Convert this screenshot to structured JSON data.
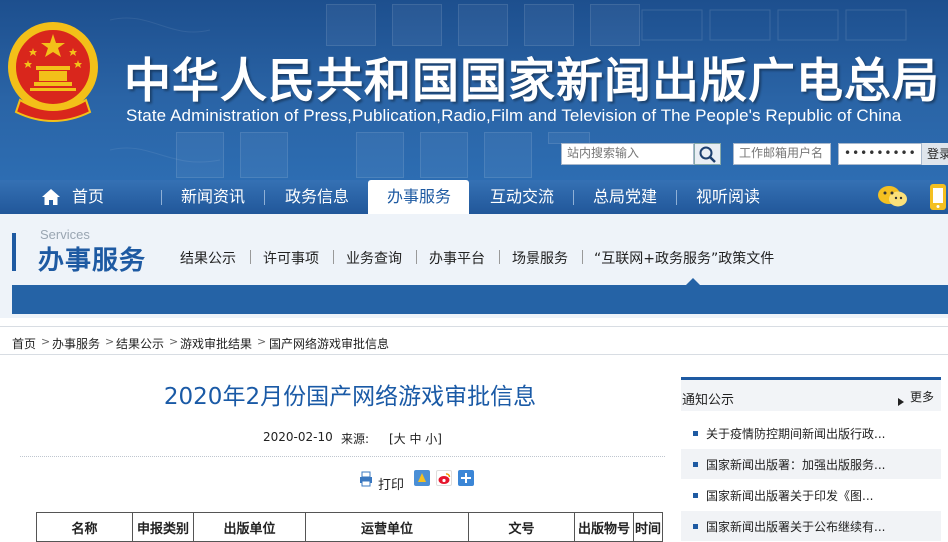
{
  "header": {
    "title": "中华人民共和国国家新闻出版广电总局",
    "subtitle": "State Administration of Press,Publication,Radio,Film and Television of The People's Republic of China",
    "search": {
      "placeholder": "站内搜索输入",
      "icon": "search-icon"
    },
    "mail": {
      "placeholder": "工作邮箱用户名"
    },
    "password": {
      "value": "•••••••••"
    },
    "login_label": "登录"
  },
  "nav": {
    "items": [
      {
        "label": "首页",
        "icon": "home-icon"
      },
      {
        "label": "新闻资讯"
      },
      {
        "label": "政务信息"
      },
      {
        "label": "办事服务",
        "active": true
      },
      {
        "label": "互动交流"
      },
      {
        "label": "总局党建"
      },
      {
        "label": "视听阅读"
      }
    ],
    "right_icons": [
      "wechat-icon",
      "mobile-icon"
    ]
  },
  "section": {
    "en": "Services",
    "cn": "办事服务",
    "items": [
      {
        "label": "结果公示"
      },
      {
        "label": "许可事项"
      },
      {
        "label": "业务查询"
      },
      {
        "label": "办事平台"
      },
      {
        "label": "场景服务"
      },
      {
        "label": "“互联网+政务服务”政策文件"
      }
    ]
  },
  "breadcrumb": {
    "items": [
      "首页",
      "办事服务",
      "结果公示",
      "游戏审批结果",
      "国产网络游戏审批信息"
    ],
    "separator": ">"
  },
  "article": {
    "title": "2020年2月份国产网络游戏审批信息",
    "date": "2020-02-10",
    "source_label": "来源:",
    "size_control": "[大 中 小]",
    "print_label": "打印",
    "table_headers": [
      "名称",
      "申报类别",
      "出版单位",
      "运营单位",
      "文号",
      "出版物号",
      "时间"
    ]
  },
  "sidebar": {
    "title": "通知公示",
    "more_label": "更多",
    "items": [
      "关于疫情防控期间新闻出版行政...",
      "国家新闻出版署：加强出版服务...",
      "国家新闻出版署关于印发《图...",
      "国家新闻出版署关于公布继续有..."
    ]
  },
  "colors": {
    "header_blue": "#2a64a6",
    "nav_blue": "#2d6db2",
    "accent_blue": "#1e5aa2",
    "title_blue": "#1a5aa6"
  }
}
